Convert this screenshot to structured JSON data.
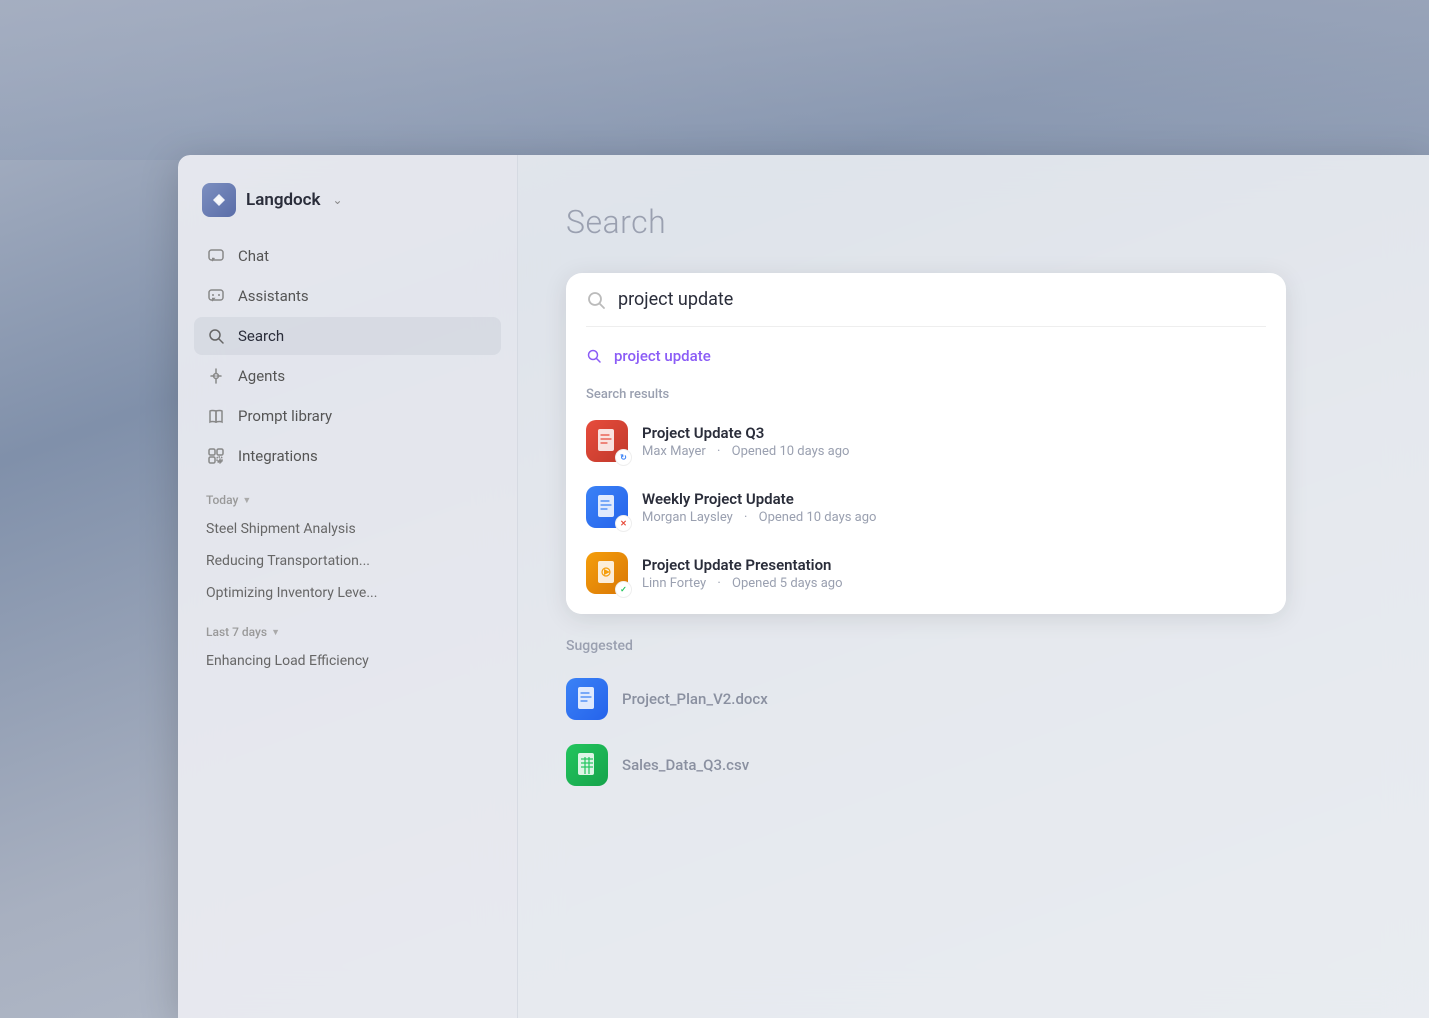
{
  "app": {
    "name": "Langdock",
    "title": "Search"
  },
  "sidebar": {
    "nav": [
      {
        "id": "chat",
        "label": "Chat",
        "icon": "chat"
      },
      {
        "id": "assistants",
        "label": "Assistants",
        "icon": "assistants"
      },
      {
        "id": "search",
        "label": "Search",
        "icon": "search",
        "active": true
      },
      {
        "id": "agents",
        "label": "Agents",
        "icon": "agents"
      },
      {
        "id": "prompt-library",
        "label": "Prompt library",
        "icon": "book"
      },
      {
        "id": "integrations",
        "label": "Integrations",
        "icon": "integrations"
      }
    ],
    "sections": [
      {
        "label": "Today",
        "items": [
          "Steel Shipment Analysis",
          "Reducing Transportation...",
          "Optimizing Inventory Leve..."
        ]
      },
      {
        "label": "Last 7 days",
        "items": [
          "Enhancing Load Efficiency"
        ]
      }
    ]
  },
  "search": {
    "page_title": "Search",
    "query": "project update",
    "dropdown_suggestion": "project update",
    "results_label": "Search results",
    "results": [
      {
        "name": "Project Update Q3",
        "author": "Max Mayer",
        "opened": "Opened 10 days ago",
        "type": "pdf"
      },
      {
        "name": "Weekly Project Update",
        "author": "Morgan Laysley",
        "opened": "Opened 10 days ago",
        "type": "doc"
      },
      {
        "name": "Project Update Presentation",
        "author": "Linn Fortey",
        "opened": "Opened 5 days ago",
        "type": "ppt"
      }
    ],
    "suggested_label": "Suggested",
    "suggested": [
      {
        "name": "Project_Plan_V2.docx",
        "type": "doc-blue"
      },
      {
        "name": "Sales_Data_Q3.csv",
        "type": "sheet-green"
      }
    ]
  }
}
